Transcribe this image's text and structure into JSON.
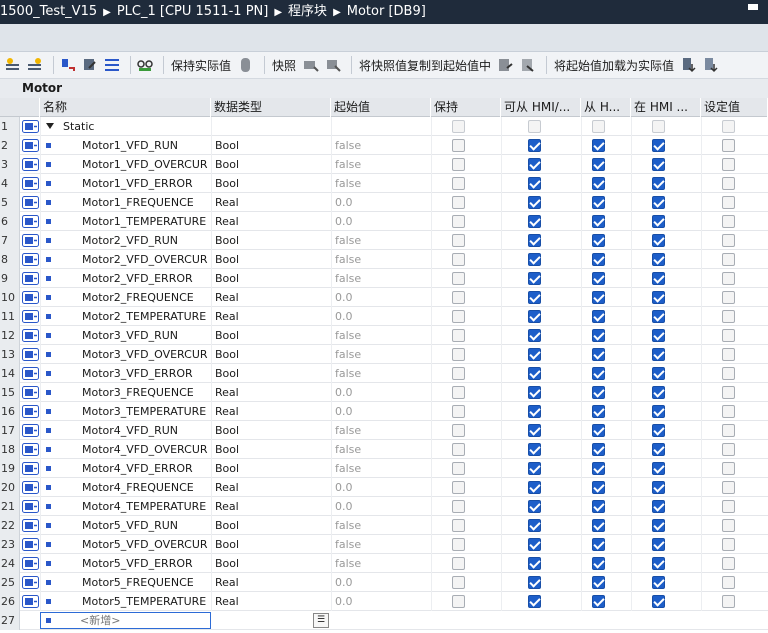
{
  "breadcrumb": [
    "1500_Test_V15",
    "PLC_1 [CPU 1511-1 PN]",
    "程序块",
    "Motor [DB9]"
  ],
  "toolbar": {
    "keep_actual": "保持实际值",
    "snapshot": "快照",
    "copy_snapshot_to_start": "将快照值复制到起始值中",
    "load_start_as_actual": "将起始值加载为实际值"
  },
  "block_title": "Motor",
  "columns": {
    "name": "名称",
    "datatype": "数据类型",
    "start": "起始值",
    "retain": "保持",
    "hmi_access": "可从 HMI/...",
    "hmi_visible": "从 H...",
    "hmi_writable": "在 HMI ...",
    "setpoint": "设定值"
  },
  "static_label": "Static",
  "rows": [
    {
      "num": "1",
      "name": "Static",
      "type": "",
      "start": "",
      "kind": "static"
    },
    {
      "num": "2",
      "name": "Motor1_VFD_RUN",
      "type": "Bool",
      "start": "false"
    },
    {
      "num": "3",
      "name": "Motor1_VFD_OVERCUR",
      "type": "Bool",
      "start": "false"
    },
    {
      "num": "4",
      "name": "Motor1_VFD_ERROR",
      "type": "Bool",
      "start": "false"
    },
    {
      "num": "5",
      "name": "Motor1_FREQUENCE",
      "type": "Real",
      "start": "0.0"
    },
    {
      "num": "6",
      "name": "Motor1_TEMPERATURE",
      "type": "Real",
      "start": "0.0"
    },
    {
      "num": "7",
      "name": "Motor2_VFD_RUN",
      "type": "Bool",
      "start": "false"
    },
    {
      "num": "8",
      "name": "Motor2_VFD_OVERCUR",
      "type": "Bool",
      "start": "false"
    },
    {
      "num": "9",
      "name": "Motor2_VFD_ERROR",
      "type": "Bool",
      "start": "false"
    },
    {
      "num": "10",
      "name": "Motor2_FREQUENCE",
      "type": "Real",
      "start": "0.0"
    },
    {
      "num": "11",
      "name": "Motor2_TEMPERATURE",
      "type": "Real",
      "start": "0.0"
    },
    {
      "num": "12",
      "name": "Motor3_VFD_RUN",
      "type": "Bool",
      "start": "false"
    },
    {
      "num": "13",
      "name": "Motor3_VFD_OVERCUR",
      "type": "Bool",
      "start": "false"
    },
    {
      "num": "14",
      "name": "Motor3_VFD_ERROR",
      "type": "Bool",
      "start": "false"
    },
    {
      "num": "15",
      "name": "Motor3_FREQUENCE",
      "type": "Real",
      "start": "0.0"
    },
    {
      "num": "16",
      "name": "Motor3_TEMPERATURE",
      "type": "Real",
      "start": "0.0"
    },
    {
      "num": "17",
      "name": "Motor4_VFD_RUN",
      "type": "Bool",
      "start": "false"
    },
    {
      "num": "18",
      "name": "Motor4_VFD_OVERCUR",
      "type": "Bool",
      "start": "false"
    },
    {
      "num": "19",
      "name": "Motor4_VFD_ERROR",
      "type": "Bool",
      "start": "false"
    },
    {
      "num": "20",
      "name": "Motor4_FREQUENCE",
      "type": "Real",
      "start": "0.0"
    },
    {
      "num": "21",
      "name": "Motor4_TEMPERATURE",
      "type": "Real",
      "start": "0.0"
    },
    {
      "num": "22",
      "name": "Motor5_VFD_RUN",
      "type": "Bool",
      "start": "false"
    },
    {
      "num": "23",
      "name": "Motor5_VFD_OVERCUR",
      "type": "Bool",
      "start": "false"
    },
    {
      "num": "24",
      "name": "Motor5_VFD_ERROR",
      "type": "Bool",
      "start": "false"
    },
    {
      "num": "25",
      "name": "Motor5_FREQUENCE",
      "type": "Real",
      "start": "0.0"
    },
    {
      "num": "26",
      "name": "Motor5_TEMPERATURE",
      "type": "Real",
      "start": "0.0"
    }
  ],
  "new_row": {
    "num": "27",
    "placeholder": "<新增>"
  },
  "colors": {
    "titlebar": "#1f2b3b",
    "checkbox_on": "#1d5ec9",
    "db_icon": "#2a57c9"
  }
}
